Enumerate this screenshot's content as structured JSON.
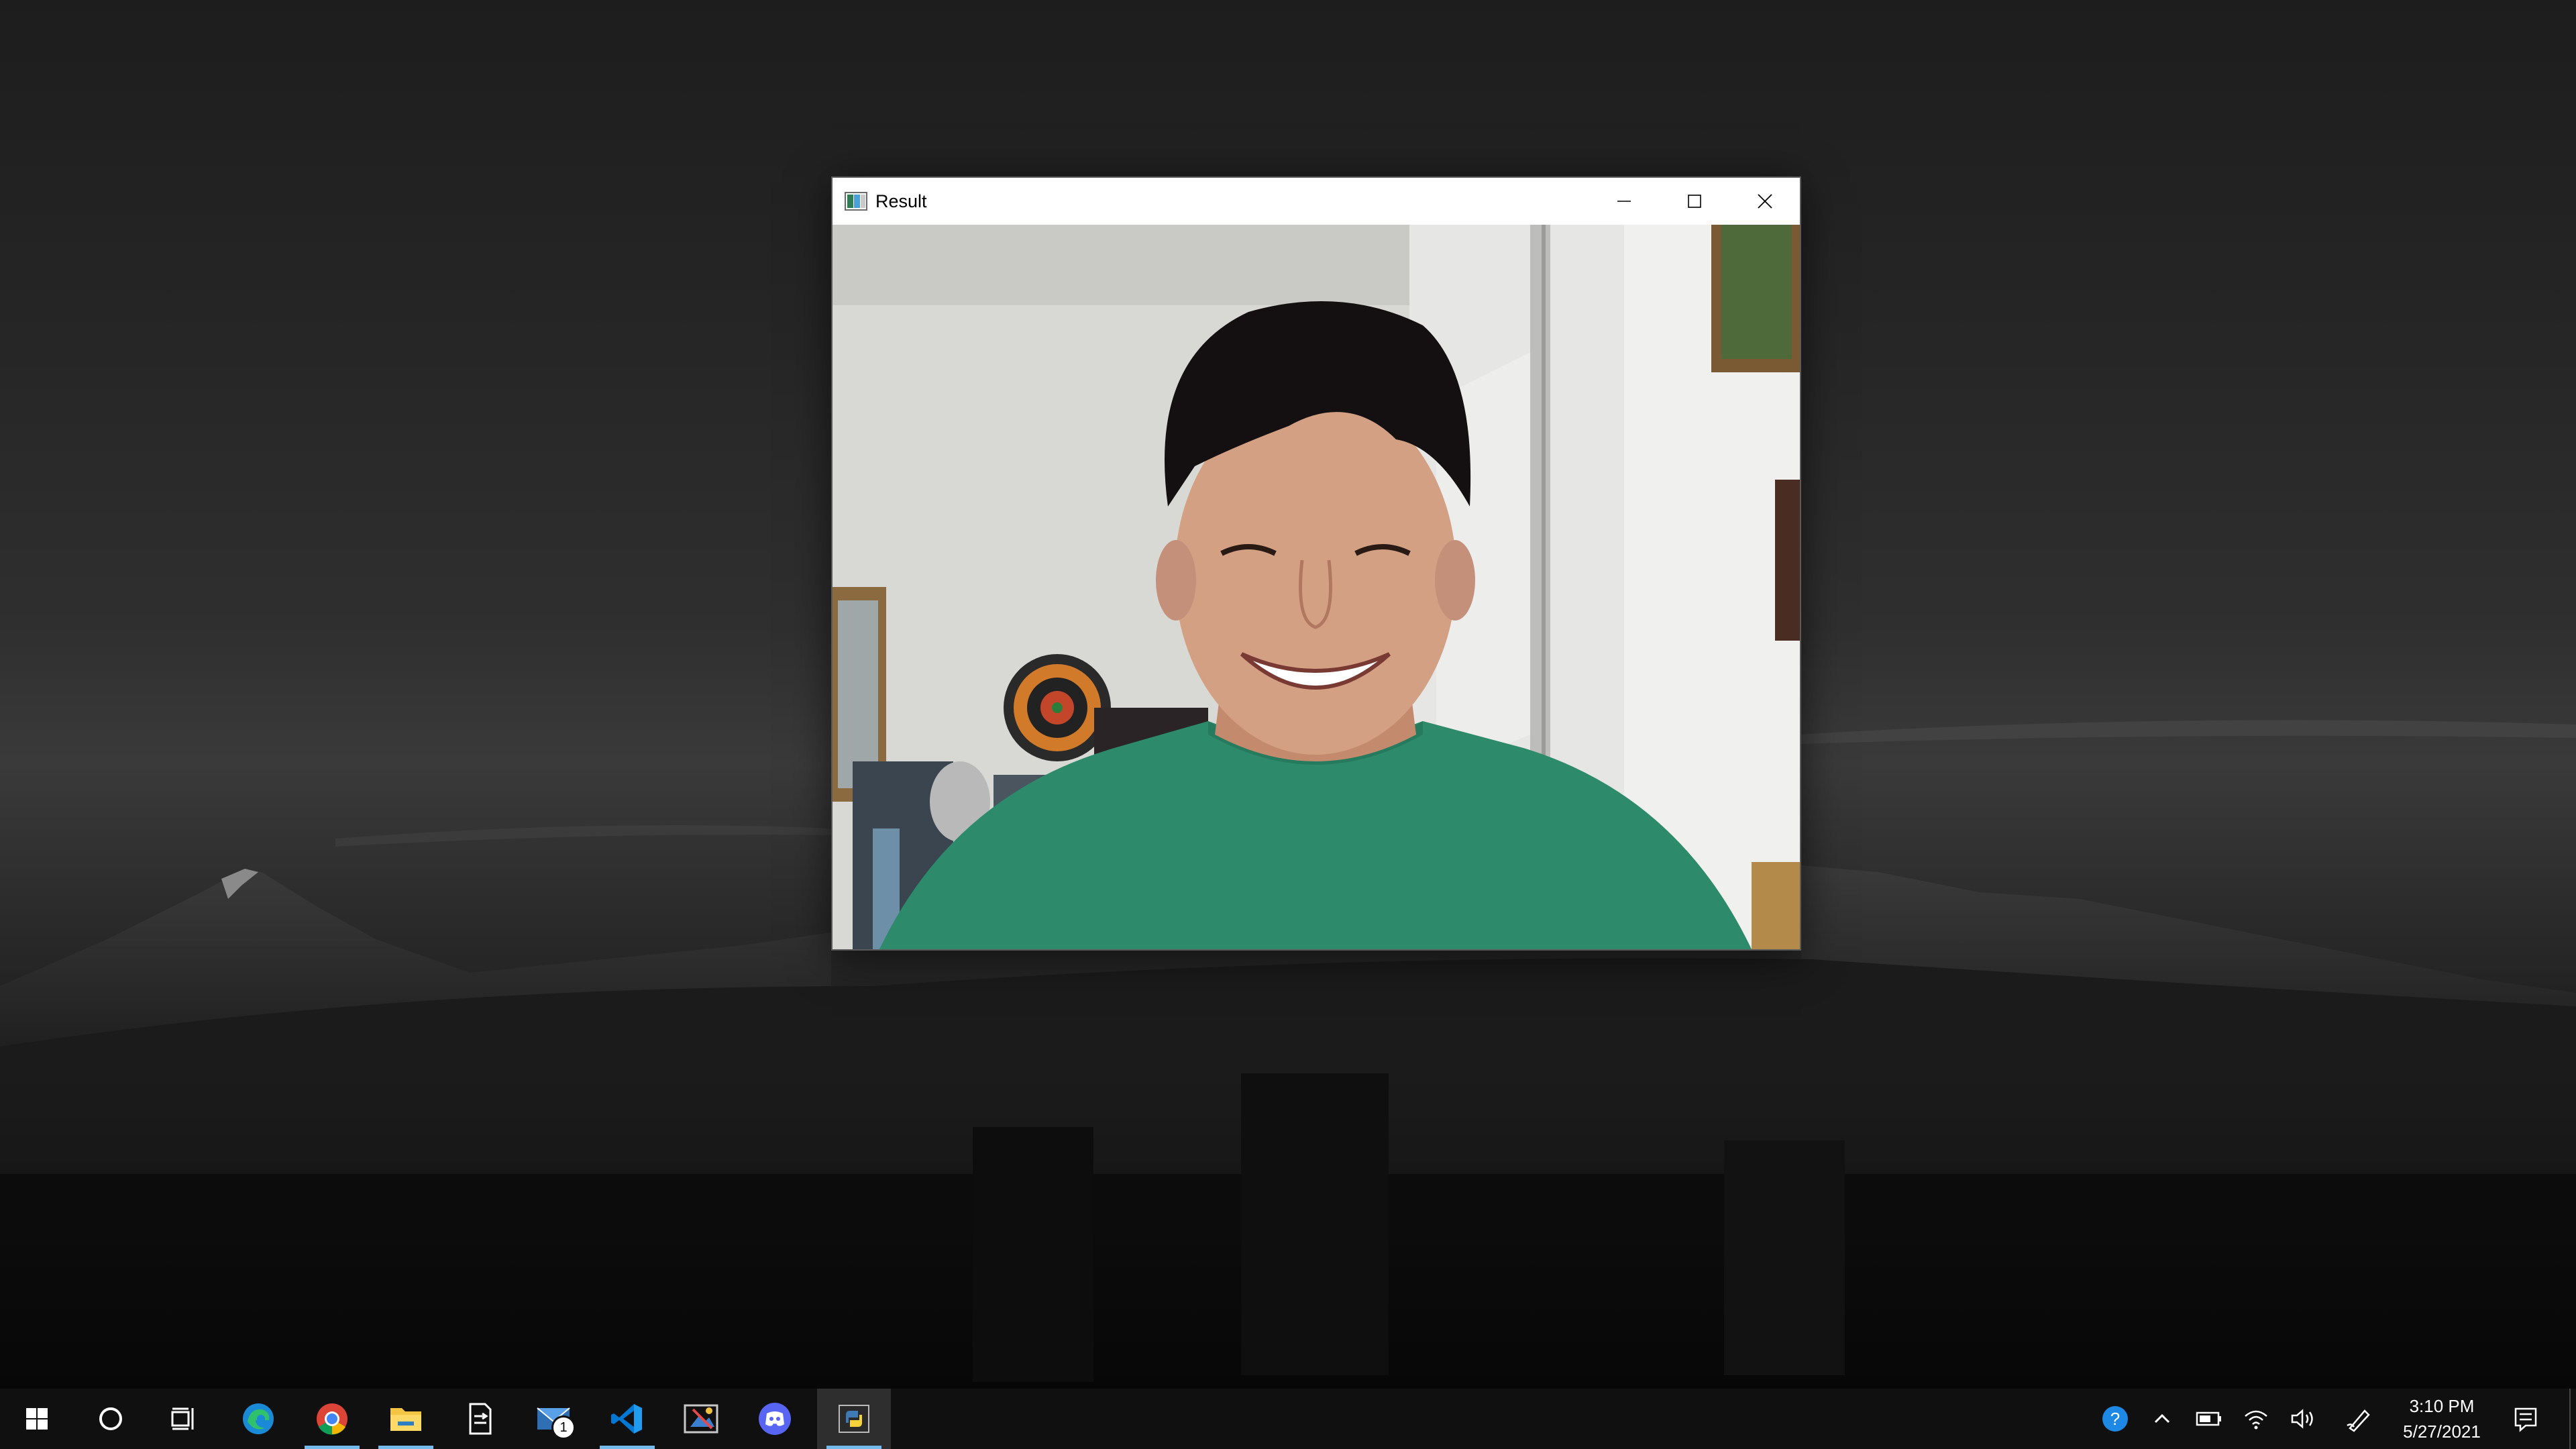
{
  "window": {
    "title": "Result",
    "app_icon": "opencv-window-icon",
    "controls": [
      "minimize-icon",
      "maximize-icon",
      "close-icon"
    ]
  },
  "viewport": {
    "content": "webcam frame"
  },
  "taskbar": {
    "items": [
      {
        "name": "start",
        "icon": "windows-logo-icon"
      },
      {
        "name": "search",
        "icon": "cortana-circle-icon"
      },
      {
        "name": "task-view",
        "icon": "task-view-icon"
      },
      {
        "name": "edge",
        "icon": "edge-icon"
      },
      {
        "name": "chrome",
        "icon": "chrome-icon",
        "running": true
      },
      {
        "name": "file-explorer",
        "icon": "folder-icon",
        "running": true
      },
      {
        "name": "app-unknown",
        "icon": "document-arrows-icon"
      },
      {
        "name": "mail",
        "icon": "mail-icon",
        "badge": "1"
      },
      {
        "name": "vscode",
        "icon": "vscode-icon",
        "running": true
      },
      {
        "name": "snipping",
        "icon": "snip-icon"
      },
      {
        "name": "discord",
        "icon": "discord-icon"
      },
      {
        "name": "python",
        "icon": "python-icon",
        "active": true
      }
    ],
    "tray": [
      "help-icon",
      "chevron-up-icon",
      "battery-icon",
      "wifi-icon",
      "volume-icon",
      "pen-icon"
    ],
    "clock": {
      "time": "3:10 PM",
      "date": "5/27/2021"
    },
    "notification_icon": "notification-icon"
  },
  "colors": {
    "taskbar_bg": "#101010",
    "running_indicator": "#76b9ed",
    "shirt": "#2d8a6b",
    "wall": "#d6d6d3"
  }
}
